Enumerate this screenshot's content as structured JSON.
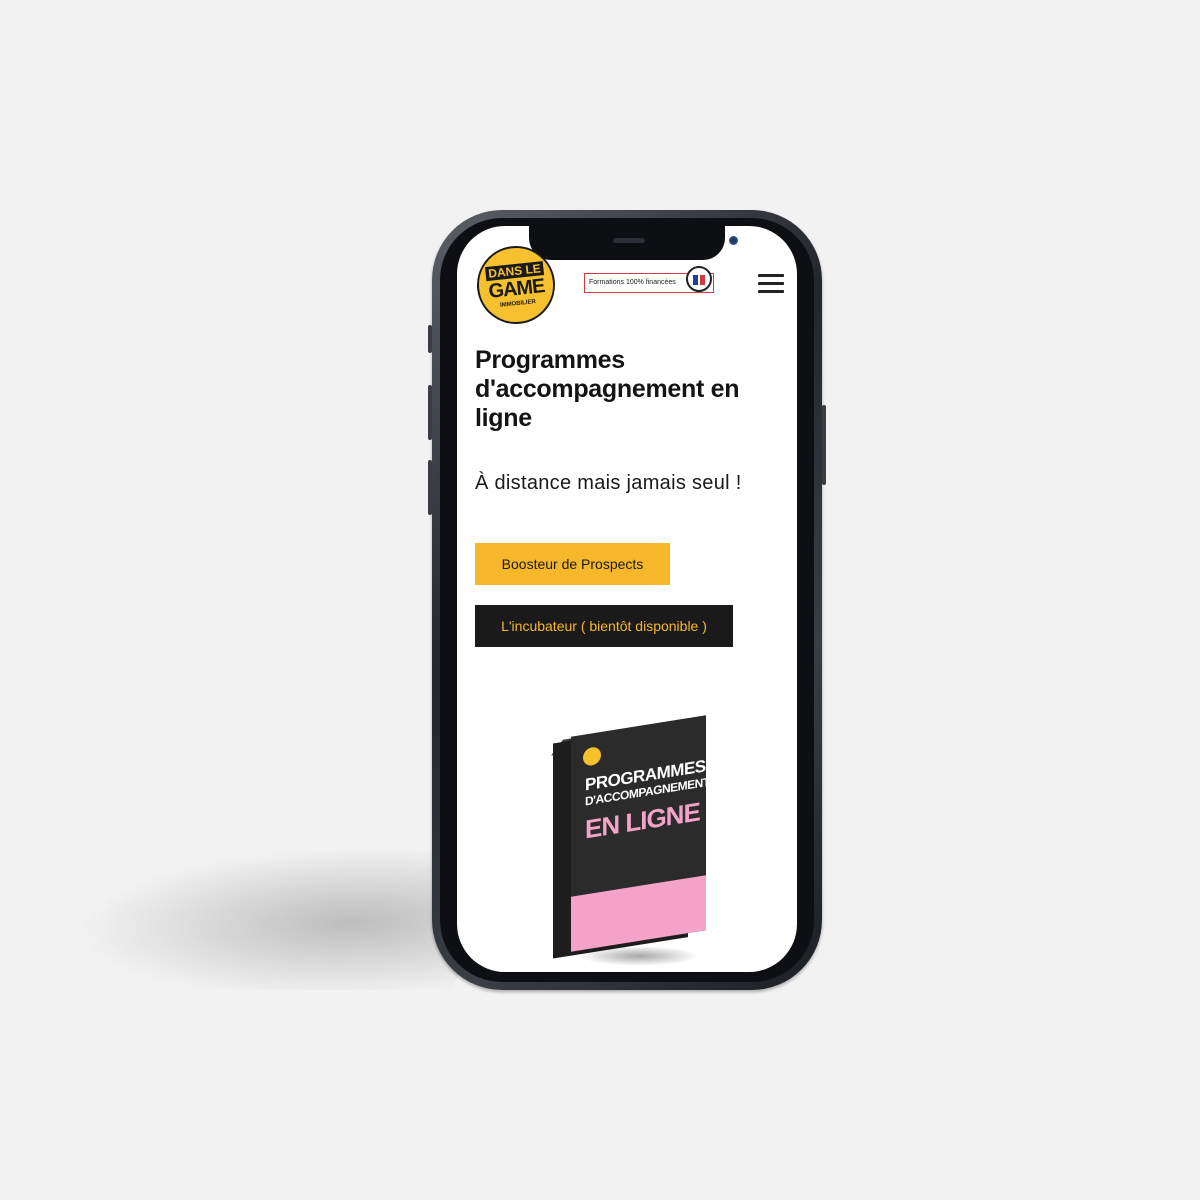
{
  "header": {
    "logo": {
      "line1": "DANS LE",
      "line2": "GAME",
      "line3": "IMMOBILIER"
    },
    "badge_text": "Formations 100% financées",
    "menu_icon": "hamburger-menu-icon"
  },
  "hero": {
    "title": "Programmes d'accompagnement en ligne",
    "subtitle": "À distance mais jamais seul !"
  },
  "buttons": {
    "primary": "Boosteur de Prospects",
    "secondary": "L'incubateur ( bientôt disponible )"
  },
  "product_box": {
    "line1": "PROGRAMMES",
    "line2": "D'ACCOMPAGNEMENT",
    "line3": "EN LIGNE"
  },
  "colors": {
    "accent": "#f6b82a",
    "dark": "#1a1a1a",
    "pink": "#f2a3c7",
    "background": "#f2f2f2"
  }
}
